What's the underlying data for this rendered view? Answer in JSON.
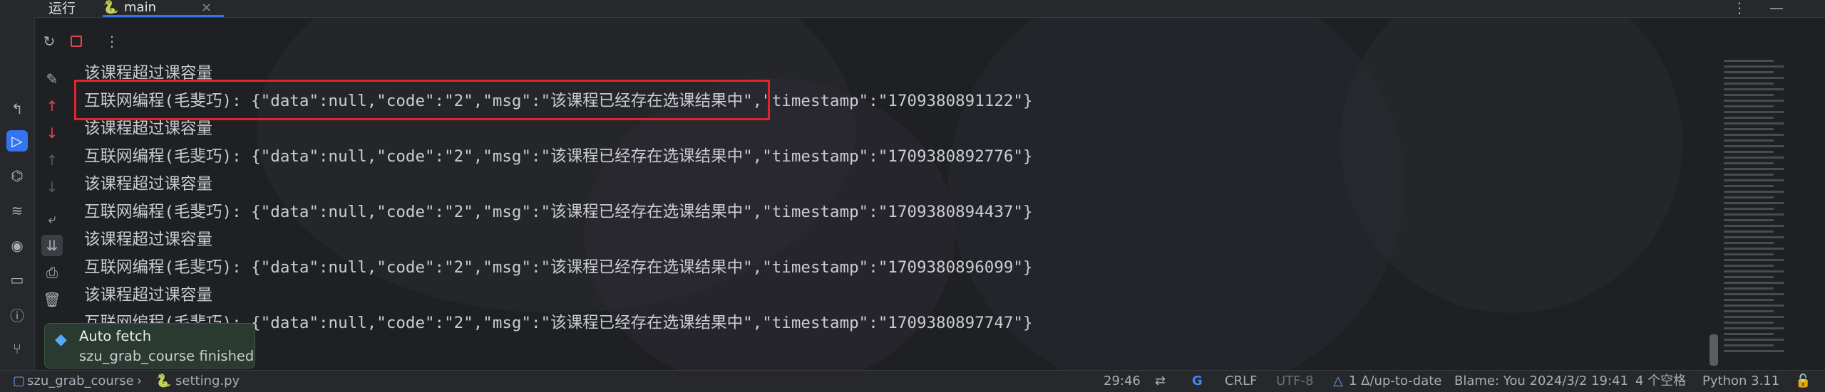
{
  "window": {
    "run_title": "运行",
    "tab_label": "main",
    "tab_close": "×"
  },
  "console": {
    "lines": [
      "该课程超过课容量",
      "互联网编程(毛斐巧): {\"data\":null,\"code\":\"2\",\"msg\":\"该课程已经存在选课结果中\",\"timestamp\":\"1709380891122\"}",
      "该课程超过课容量",
      "互联网编程(毛斐巧): {\"data\":null,\"code\":\"2\",\"msg\":\"该课程已经存在选课结果中\",\"timestamp\":\"1709380892776\"}",
      "该课程超过课容量",
      "互联网编程(毛斐巧): {\"data\":null,\"code\":\"2\",\"msg\":\"该课程已经存在选课结果中\",\"timestamp\":\"1709380894437\"}",
      "该课程超过课容量",
      "互联网编程(毛斐巧): {\"data\":null,\"code\":\"2\",\"msg\":\"该课程已经存在选课结果中\",\"timestamp\":\"1709380896099\"}",
      "该课程超过课容量",
      "互联网编程(毛斐巧): {\"data\":null,\"code\":\"2\",\"msg\":\"该课程已经存在选课结果中\",\"timestamp\":\"1709380897747\"}"
    ]
  },
  "notification": {
    "title": "Auto fetch",
    "message": "szu_grab_course finished"
  },
  "status_bar": {
    "project": "szu_grab_course",
    "file": "setting.py",
    "position": "29:46",
    "line_separator": "CRLF",
    "encoding": "UTF-8",
    "vcs": "1 Δ/up-to-date",
    "blame": "Blame: You 2024/3/2 19:41",
    "indent": "4 个空格",
    "interpreter": "Python 3.11"
  },
  "colors": {
    "accent": "#3574f0",
    "highlight_border": "#e0242e",
    "stop": "#e0464c",
    "notification_bg": "#2b3a31"
  },
  "icons": [
    "commit-icon",
    "run-icon",
    "python-console-icon",
    "layers-icon",
    "services-icon",
    "terminal-icon",
    "problems-icon",
    "git-icon",
    "rerun-icon",
    "stop-icon",
    "more-icon",
    "pencil-icon",
    "arrow-up-icon",
    "arrow-down-icon",
    "soft-wrap-icon",
    "scroll-to-end-icon",
    "print-icon",
    "trash-icon"
  ]
}
